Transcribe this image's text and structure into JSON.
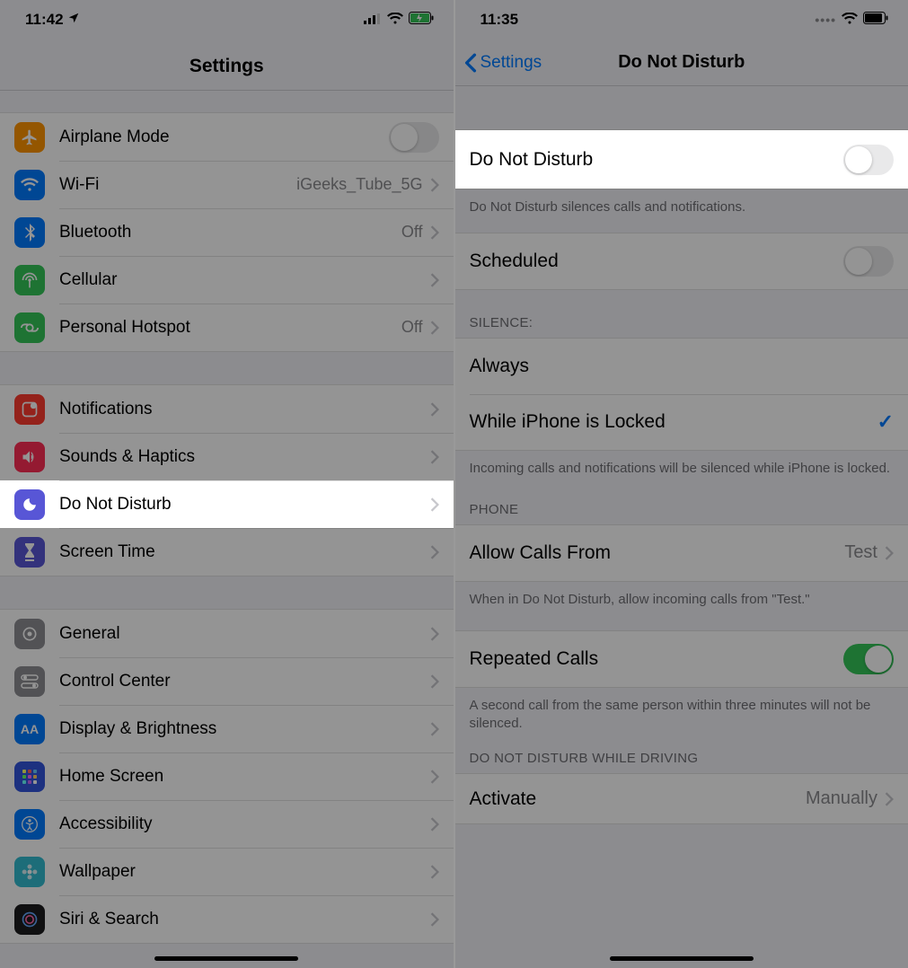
{
  "left": {
    "status": {
      "time": "11:42"
    },
    "title": "Settings",
    "group1": [
      {
        "label": "Airplane Mode",
        "type": "toggle",
        "on": false,
        "icon": "airplane",
        "color": "#ff9500"
      },
      {
        "label": "Wi-Fi",
        "value": "iGeeks_Tube_5G",
        "icon": "wifi",
        "color": "#007aff"
      },
      {
        "label": "Bluetooth",
        "value": "Off",
        "icon": "bluetooth",
        "color": "#007aff"
      },
      {
        "label": "Cellular",
        "value": "",
        "icon": "antenna",
        "color": "#34c759"
      },
      {
        "label": "Personal Hotspot",
        "value": "Off",
        "icon": "hotspot",
        "color": "#34c759"
      }
    ],
    "group2": [
      {
        "label": "Notifications",
        "icon": "notification",
        "color": "#ff3b30"
      },
      {
        "label": "Sounds & Haptics",
        "icon": "speaker",
        "color": "#ff2d55"
      },
      {
        "label": "Do Not Disturb",
        "icon": "moon",
        "color": "#5856d6",
        "highlight": true
      },
      {
        "label": "Screen Time",
        "icon": "hourglass",
        "color": "#5856d6"
      }
    ],
    "group3": [
      {
        "label": "General",
        "icon": "gear",
        "color": "#8e8e93"
      },
      {
        "label": "Control Center",
        "icon": "switches",
        "color": "#8e8e93"
      },
      {
        "label": "Display & Brightness",
        "icon": "aa",
        "color": "#007aff"
      },
      {
        "label": "Home Screen",
        "icon": "grid",
        "color": "#3355dd"
      },
      {
        "label": "Accessibility",
        "icon": "person",
        "color": "#007aff"
      },
      {
        "label": "Wallpaper",
        "icon": "flower",
        "color": "#33bcd1"
      },
      {
        "label": "Siri & Search",
        "icon": "siri",
        "color": "#1c1c1e"
      }
    ]
  },
  "right": {
    "status": {
      "time": "11:35"
    },
    "back": "Settings",
    "title": "Do Not Disturb",
    "dnd": {
      "label": "Do Not Disturb",
      "on": false
    },
    "dnd_footer": "Do Not Disturb silences calls and notifications.",
    "scheduled": {
      "label": "Scheduled",
      "on": false
    },
    "silence_header": "SILENCE:",
    "silence_options": [
      {
        "label": "Always",
        "checked": false
      },
      {
        "label": "While iPhone is Locked",
        "checked": true
      }
    ],
    "silence_footer": "Incoming calls and notifications will be silenced while iPhone is locked.",
    "phone_header": "PHONE",
    "allow_calls": {
      "label": "Allow Calls From",
      "value": "Test"
    },
    "allow_footer": "When in Do Not Disturb, allow incoming calls from \"Test.\"",
    "repeated": {
      "label": "Repeated Calls",
      "on": true
    },
    "repeated_footer": "A second call from the same person within three minutes will not be silenced.",
    "driving_header": "DO NOT DISTURB WHILE DRIVING",
    "activate": {
      "label": "Activate",
      "value": "Manually"
    }
  }
}
